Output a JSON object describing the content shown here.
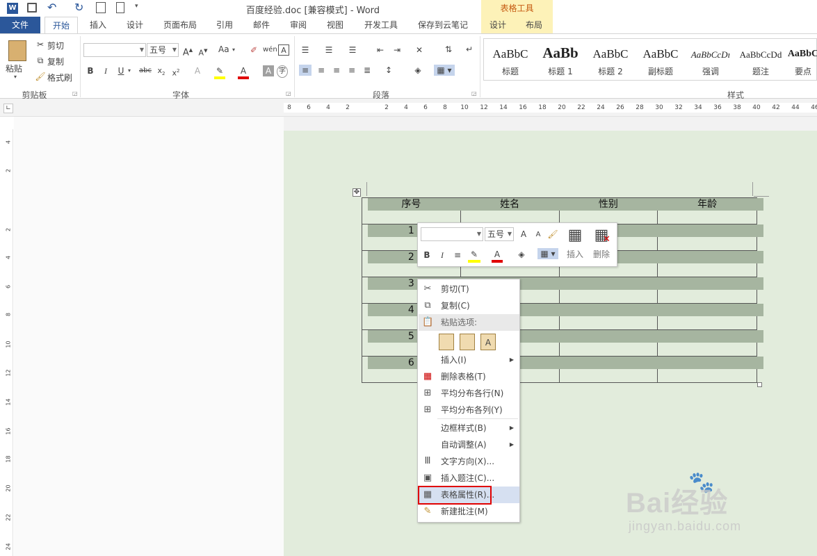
{
  "title_bar": {
    "title": "百度经验.doc [兼容模式] - Word",
    "context_group": "表格工具"
  },
  "tabs": [
    {
      "label": "文件"
    },
    {
      "label": "开始"
    },
    {
      "label": "插入"
    },
    {
      "label": "设计"
    },
    {
      "label": "页面布局"
    },
    {
      "label": "引用"
    },
    {
      "label": "邮件"
    },
    {
      "label": "审阅"
    },
    {
      "label": "视图"
    },
    {
      "label": "开发工具"
    },
    {
      "label": "保存到云笔记"
    },
    {
      "label": "设计"
    },
    {
      "label": "布局"
    }
  ],
  "ribbon": {
    "clipboard": {
      "paste": "粘贴",
      "cut": "剪切",
      "copy": "复制",
      "format_painter": "格式刷",
      "group": "剪贴板"
    },
    "font": {
      "font_name": "",
      "font_size": "五号",
      "change_case": "Aa",
      "group": "字体"
    },
    "paragraph": {
      "group": "段落"
    },
    "styles": {
      "group": "样式",
      "items": [
        {
          "sample": "AaBbC",
          "name": "标题"
        },
        {
          "sample": "AaBb",
          "name": "标题 1"
        },
        {
          "sample": "AaBbC",
          "name": "标题 2"
        },
        {
          "sample": "AaBbC",
          "name": "副标题"
        },
        {
          "sample": "AaBbCcDı",
          "name": "强调"
        },
        {
          "sample": "AaBbCcDd",
          "name": "题注"
        },
        {
          "sample": "AaBbC",
          "name": "要点"
        }
      ]
    }
  },
  "hruler_labels": [
    "8",
    "6",
    "4",
    "2",
    "2",
    "4",
    "6",
    "8",
    "10",
    "12",
    "14",
    "16",
    "18",
    "20",
    "22",
    "24",
    "26",
    "28",
    "30",
    "32",
    "34",
    "36",
    "38",
    "40",
    "42",
    "44",
    "46"
  ],
  "vruler_labels": [
    "4",
    "2",
    "2",
    "4",
    "6",
    "8",
    "10",
    "12",
    "14",
    "16",
    "18",
    "20",
    "22",
    "24"
  ],
  "table": {
    "headers": [
      "序号",
      "姓名",
      "性别",
      "年龄"
    ],
    "rows": [
      [
        "1",
        "",
        "",
        ""
      ],
      [
        "2",
        "",
        "",
        ""
      ],
      [
        "3",
        "",
        "",
        ""
      ],
      [
        "4",
        "",
        "",
        ""
      ],
      [
        "5",
        "",
        "",
        ""
      ],
      [
        "6",
        "",
        "",
        ""
      ]
    ]
  },
  "mini_toolbar": {
    "font_size": "五号",
    "insert": "插入",
    "delete": "删除"
  },
  "context_menu": {
    "cut": "剪切(T)",
    "copy": "复制(C)",
    "paste_options": "粘贴选项:",
    "insert": "插入(I)",
    "delete_table": "删除表格(T)",
    "distribute_rows": "平均分布各行(N)",
    "distribute_cols": "平均分布各列(Y)",
    "border_styles": "边框样式(B)",
    "autofit": "自动调整(A)",
    "text_direction": "文字方向(X)...",
    "insert_caption": "插入题注(C)...",
    "table_properties": "表格属性(R)...",
    "new_comment": "新建批注(M)"
  },
  "watermark": {
    "brand": "Bai经验",
    "url": "jingyan.baidu.com"
  },
  "colors": {
    "accent": "#2b579a",
    "context_tab": "#fdf2b8",
    "highlight": "#e00000",
    "cell_shading": "#a6b5a0",
    "page_bg": "#e2ecdc"
  }
}
